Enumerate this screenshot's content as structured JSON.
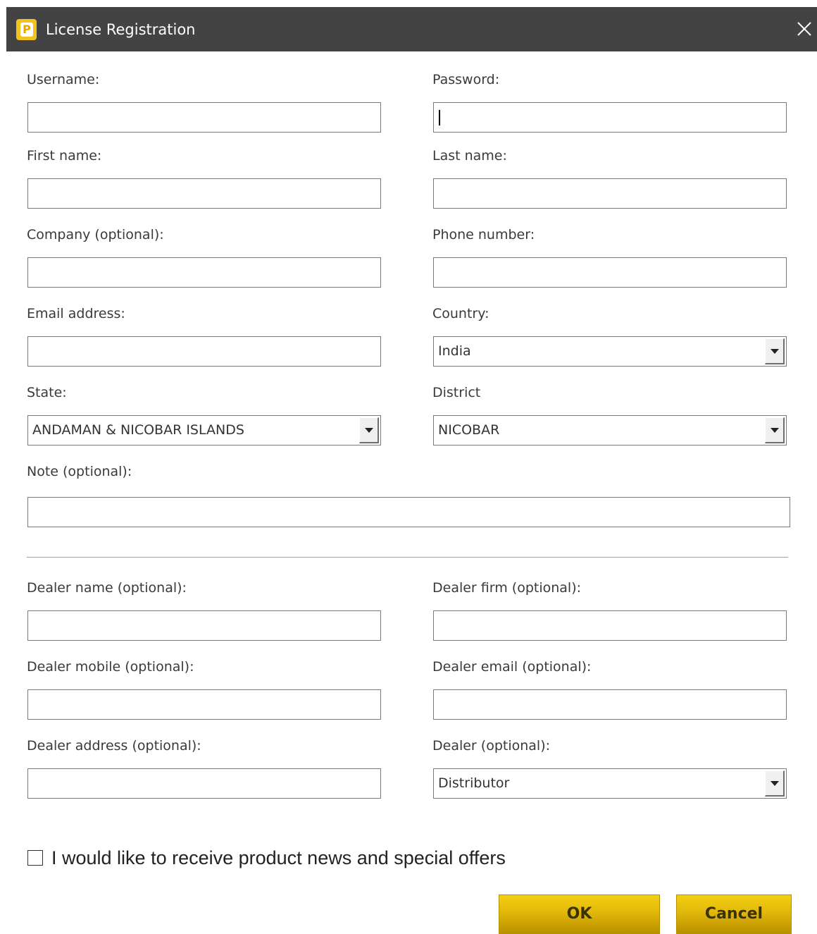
{
  "window": {
    "title": "License Registration",
    "icon_letter": "P"
  },
  "form": {
    "username": {
      "label": "Username:",
      "value": ""
    },
    "password": {
      "label": "Password:",
      "value": ""
    },
    "first_name": {
      "label": "First name:",
      "value": ""
    },
    "last_name": {
      "label": "Last name:",
      "value": ""
    },
    "company": {
      "label": "Company (optional):",
      "value": ""
    },
    "phone": {
      "label": "Phone number:",
      "value": ""
    },
    "email": {
      "label": "Email address:",
      "value": ""
    },
    "country": {
      "label": "Country:",
      "value": "India"
    },
    "state": {
      "label": "State:",
      "value": "ANDAMAN & NICOBAR ISLANDS"
    },
    "district": {
      "label": "District",
      "value": "NICOBAR"
    },
    "note": {
      "label": "Note (optional):",
      "value": ""
    }
  },
  "dealer": {
    "name": {
      "label": "Dealer name (optional):",
      "value": ""
    },
    "firm": {
      "label": "Dealer firm (optional):",
      "value": ""
    },
    "mobile": {
      "label": "Dealer mobile (optional):",
      "value": ""
    },
    "email": {
      "label": "Dealer email (optional):",
      "value": ""
    },
    "address": {
      "label": "Dealer address (optional):",
      "value": ""
    },
    "type": {
      "label": "Dealer (optional):",
      "value": "Distributor"
    }
  },
  "newsletter": {
    "label": "I would like to receive product news and special offers",
    "checked": false
  },
  "buttons": {
    "ok": "OK",
    "cancel": "Cancel"
  },
  "colors": {
    "titlebar": "#434343",
    "button_gold": "#e2b70a",
    "icon_yellow": "#f4c21c"
  },
  "icons": {
    "app": "app-logo-icon",
    "close": "close-icon",
    "dropdown": "chevron-down-icon"
  }
}
